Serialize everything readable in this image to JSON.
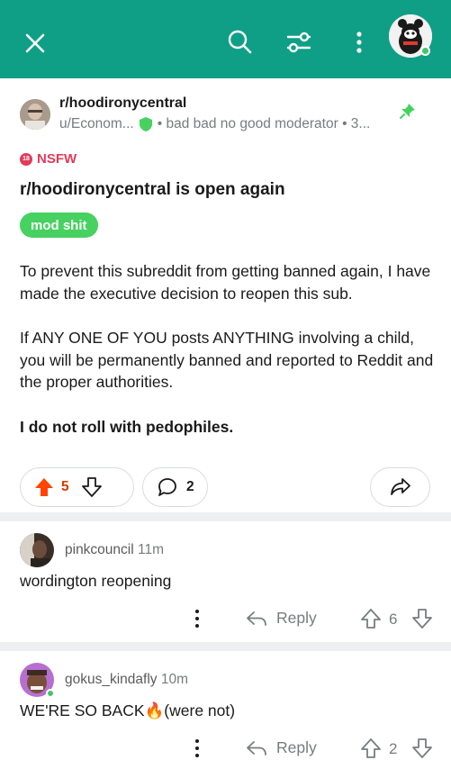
{
  "colors": {
    "header_bg": "#0f9f86",
    "upvote_active": "#ff4500",
    "nsfw": "#e13b5a",
    "flair_bg": "#46d160",
    "mod_shield": "#46d160",
    "pin": "#46d160",
    "online_dot": "#47c36b"
  },
  "header": {
    "close_icon": "close-icon",
    "search_icon": "search-icon",
    "filter_icon": "filter-sliders-icon",
    "more_icon": "more-vertical-icon",
    "avatar": "user-avatar"
  },
  "post": {
    "subreddit": "r/hoodironycentral",
    "author": "u/Econom...",
    "author_flair": "• bad bad no good moderator • 3...",
    "nsfw_badge_num": "18",
    "nsfw_label": "NSFW",
    "title": "r/hoodironycentral is open again",
    "flair": "mod shit",
    "body": {
      "p1": "To prevent this subreddit from getting banned again, I have made the executive decision to reopen this sub.",
      "p2": "If ANY ONE OF YOU posts ANYTHING involving a child, you will be permanently banned and reported to Reddit and the proper authorities.",
      "p3": "I do not roll with pedophiles."
    },
    "votes": "5",
    "upvoted": true,
    "comments": "2"
  },
  "comments": [
    {
      "username": "pinkcouncil",
      "time": "11m",
      "text": "wordington reopening",
      "reply_label": "Reply",
      "score": "6"
    },
    {
      "username": "gokus_kindafly",
      "time": "10m",
      "text": "WE'RE SO BACK🔥(were not)",
      "reply_label": "Reply",
      "score": "2"
    }
  ]
}
